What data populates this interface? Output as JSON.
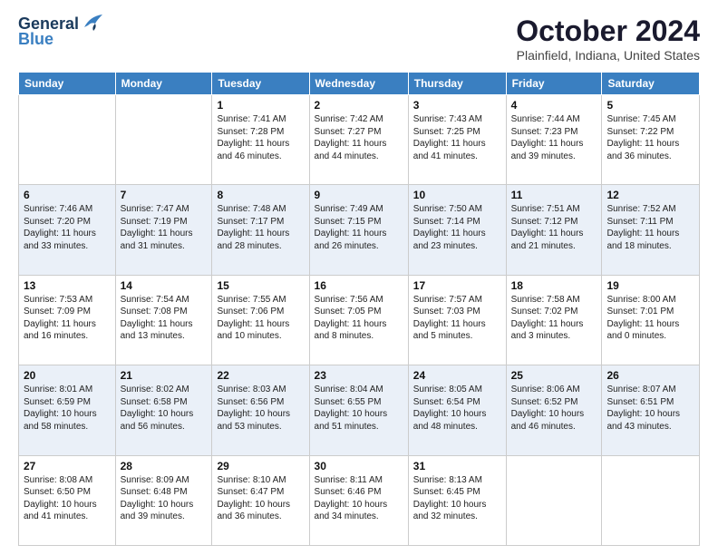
{
  "logo": {
    "line1": "General",
    "line2": "Blue"
  },
  "title": "October 2024",
  "location": "Plainfield, Indiana, United States",
  "days_header": [
    "Sunday",
    "Monday",
    "Tuesday",
    "Wednesday",
    "Thursday",
    "Friday",
    "Saturday"
  ],
  "weeks": [
    [
      {
        "num": "",
        "info": ""
      },
      {
        "num": "",
        "info": ""
      },
      {
        "num": "1",
        "info": "Sunrise: 7:41 AM\nSunset: 7:28 PM\nDaylight: 11 hours and 46 minutes."
      },
      {
        "num": "2",
        "info": "Sunrise: 7:42 AM\nSunset: 7:27 PM\nDaylight: 11 hours and 44 minutes."
      },
      {
        "num": "3",
        "info": "Sunrise: 7:43 AM\nSunset: 7:25 PM\nDaylight: 11 hours and 41 minutes."
      },
      {
        "num": "4",
        "info": "Sunrise: 7:44 AM\nSunset: 7:23 PM\nDaylight: 11 hours and 39 minutes."
      },
      {
        "num": "5",
        "info": "Sunrise: 7:45 AM\nSunset: 7:22 PM\nDaylight: 11 hours and 36 minutes."
      }
    ],
    [
      {
        "num": "6",
        "info": "Sunrise: 7:46 AM\nSunset: 7:20 PM\nDaylight: 11 hours and 33 minutes."
      },
      {
        "num": "7",
        "info": "Sunrise: 7:47 AM\nSunset: 7:19 PM\nDaylight: 11 hours and 31 minutes."
      },
      {
        "num": "8",
        "info": "Sunrise: 7:48 AM\nSunset: 7:17 PM\nDaylight: 11 hours and 28 minutes."
      },
      {
        "num": "9",
        "info": "Sunrise: 7:49 AM\nSunset: 7:15 PM\nDaylight: 11 hours and 26 minutes."
      },
      {
        "num": "10",
        "info": "Sunrise: 7:50 AM\nSunset: 7:14 PM\nDaylight: 11 hours and 23 minutes."
      },
      {
        "num": "11",
        "info": "Sunrise: 7:51 AM\nSunset: 7:12 PM\nDaylight: 11 hours and 21 minutes."
      },
      {
        "num": "12",
        "info": "Sunrise: 7:52 AM\nSunset: 7:11 PM\nDaylight: 11 hours and 18 minutes."
      }
    ],
    [
      {
        "num": "13",
        "info": "Sunrise: 7:53 AM\nSunset: 7:09 PM\nDaylight: 11 hours and 16 minutes."
      },
      {
        "num": "14",
        "info": "Sunrise: 7:54 AM\nSunset: 7:08 PM\nDaylight: 11 hours and 13 minutes."
      },
      {
        "num": "15",
        "info": "Sunrise: 7:55 AM\nSunset: 7:06 PM\nDaylight: 11 hours and 10 minutes."
      },
      {
        "num": "16",
        "info": "Sunrise: 7:56 AM\nSunset: 7:05 PM\nDaylight: 11 hours and 8 minutes."
      },
      {
        "num": "17",
        "info": "Sunrise: 7:57 AM\nSunset: 7:03 PM\nDaylight: 11 hours and 5 minutes."
      },
      {
        "num": "18",
        "info": "Sunrise: 7:58 AM\nSunset: 7:02 PM\nDaylight: 11 hours and 3 minutes."
      },
      {
        "num": "19",
        "info": "Sunrise: 8:00 AM\nSunset: 7:01 PM\nDaylight: 11 hours and 0 minutes."
      }
    ],
    [
      {
        "num": "20",
        "info": "Sunrise: 8:01 AM\nSunset: 6:59 PM\nDaylight: 10 hours and 58 minutes."
      },
      {
        "num": "21",
        "info": "Sunrise: 8:02 AM\nSunset: 6:58 PM\nDaylight: 10 hours and 56 minutes."
      },
      {
        "num": "22",
        "info": "Sunrise: 8:03 AM\nSunset: 6:56 PM\nDaylight: 10 hours and 53 minutes."
      },
      {
        "num": "23",
        "info": "Sunrise: 8:04 AM\nSunset: 6:55 PM\nDaylight: 10 hours and 51 minutes."
      },
      {
        "num": "24",
        "info": "Sunrise: 8:05 AM\nSunset: 6:54 PM\nDaylight: 10 hours and 48 minutes."
      },
      {
        "num": "25",
        "info": "Sunrise: 8:06 AM\nSunset: 6:52 PM\nDaylight: 10 hours and 46 minutes."
      },
      {
        "num": "26",
        "info": "Sunrise: 8:07 AM\nSunset: 6:51 PM\nDaylight: 10 hours and 43 minutes."
      }
    ],
    [
      {
        "num": "27",
        "info": "Sunrise: 8:08 AM\nSunset: 6:50 PM\nDaylight: 10 hours and 41 minutes."
      },
      {
        "num": "28",
        "info": "Sunrise: 8:09 AM\nSunset: 6:48 PM\nDaylight: 10 hours and 39 minutes."
      },
      {
        "num": "29",
        "info": "Sunrise: 8:10 AM\nSunset: 6:47 PM\nDaylight: 10 hours and 36 minutes."
      },
      {
        "num": "30",
        "info": "Sunrise: 8:11 AM\nSunset: 6:46 PM\nDaylight: 10 hours and 34 minutes."
      },
      {
        "num": "31",
        "info": "Sunrise: 8:13 AM\nSunset: 6:45 PM\nDaylight: 10 hours and 32 minutes."
      },
      {
        "num": "",
        "info": ""
      },
      {
        "num": "",
        "info": ""
      }
    ]
  ]
}
